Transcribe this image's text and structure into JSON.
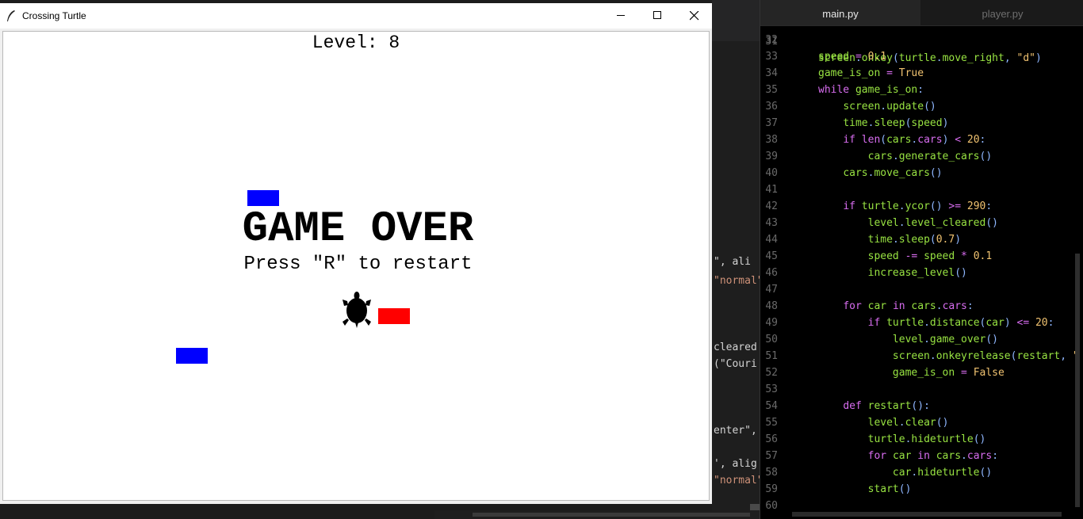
{
  "window": {
    "title": "Crossing Turtle",
    "controls": [
      "minimize",
      "maximize",
      "close"
    ]
  },
  "game": {
    "level_text": "Level: 8",
    "game_over_text": "GAME OVER",
    "restart_text": "Press \"R\" to restart",
    "colors": {
      "car_blue": "#0000ff",
      "car_red": "#ff0000",
      "turtle": "#000000"
    }
  },
  "background_editor": {
    "fragments": [
      {
        "pre": "\", ali",
        "str": ""
      },
      {
        "pre": "",
        "str": "\"normal\""
      },
      {
        "pre": "cleared",
        "str": ""
      },
      {
        "pre": "(\"Couri",
        "str": ""
      },
      {
        "pre": "enter\",",
        "str": ""
      },
      {
        "pre": "', alig",
        "str": ""
      },
      {
        "pre": "",
        "str": "\"normal\""
      }
    ]
  },
  "editor": {
    "tabs": [
      {
        "label": "main.py",
        "active": true
      },
      {
        "label": "player.py",
        "active": false
      }
    ],
    "first_line_partial": "screen.onkey(turtle.move_right, \"d\")",
    "lines": [
      {
        "n": "32",
        "code": ""
      },
      {
        "n": "33",
        "code": "speed = 0.1"
      },
      {
        "n": "34",
        "code": "game_is_on = True"
      },
      {
        "n": "35",
        "code": "while game_is_on:"
      },
      {
        "n": "36",
        "code": "    screen.update()"
      },
      {
        "n": "37",
        "code": "    time.sleep(speed)"
      },
      {
        "n": "38",
        "code": "    if len(cars.cars) < 20:"
      },
      {
        "n": "39",
        "code": "        cars.generate_cars()"
      },
      {
        "n": "40",
        "code": "    cars.move_cars()"
      },
      {
        "n": "41",
        "code": ""
      },
      {
        "n": "42",
        "code": "    if turtle.ycor() >= 290:"
      },
      {
        "n": "43",
        "code": "        level.level_cleared()"
      },
      {
        "n": "44",
        "code": "        time.sleep(0.7)"
      },
      {
        "n": "45",
        "code": "        speed -= speed * 0.1"
      },
      {
        "n": "46",
        "code": "        increase_level()"
      },
      {
        "n": "47",
        "code": ""
      },
      {
        "n": "48",
        "code": "    for car in cars.cars:"
      },
      {
        "n": "49",
        "code": "        if turtle.distance(car) <= 20:"
      },
      {
        "n": "50",
        "code": "            level.game_over()"
      },
      {
        "n": "51",
        "code": "            screen.onkeyrelease(restart, \""
      },
      {
        "n": "52",
        "code": "            game_is_on = False"
      },
      {
        "n": "53",
        "code": ""
      },
      {
        "n": "54",
        "code": "    def restart():"
      },
      {
        "n": "55",
        "code": "        level.clear()"
      },
      {
        "n": "56",
        "code": "        turtle.hideturtle()"
      },
      {
        "n": "57",
        "code": "        for car in cars.cars:"
      },
      {
        "n": "58",
        "code": "            car.hideturtle()"
      },
      {
        "n": "59",
        "code": "        start()"
      },
      {
        "n": "60",
        "code": ""
      }
    ]
  }
}
